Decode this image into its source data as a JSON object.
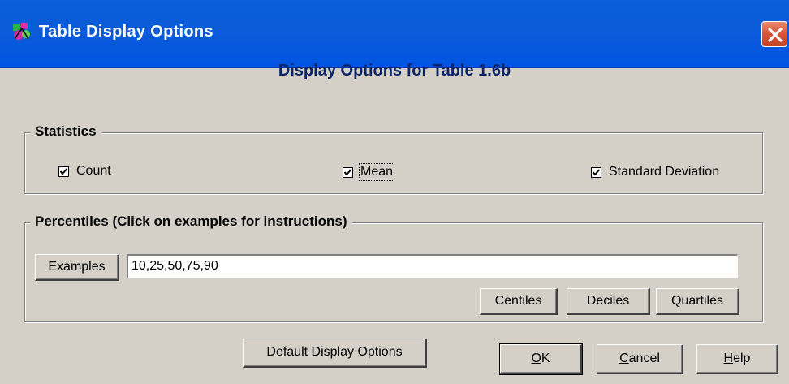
{
  "window": {
    "title": "Table Display Options",
    "app_icon": "app-icon",
    "close_icon": "close-icon"
  },
  "heading": "Display Options for Table 1.6b",
  "statistics": {
    "group_label": "Statistics",
    "count": {
      "label": "Count",
      "checked": true
    },
    "mean": {
      "label": "Mean",
      "checked": true
    },
    "std_dev": {
      "label": "Standard Deviation",
      "checked": true
    }
  },
  "percentiles": {
    "group_label": "Percentiles (Click on examples for instructions)",
    "examples_label": "Examples",
    "value": "10,25,50,75,90",
    "centiles_label": "Centiles",
    "deciles_label": "Deciles",
    "quartiles_label": "Quartiles"
  },
  "buttons": {
    "default_display_options": "Default Display Options",
    "ok_accel": "O",
    "ok_rest": "K",
    "cancel_accel": "C",
    "cancel_rest": "ancel",
    "help_accel": "H",
    "help_rest": "elp"
  },
  "colors": {
    "titlebar": "#0054e3",
    "heading": "#0a246a",
    "dialog_bg": "#d4d0c8",
    "close_button": "#d6553a"
  }
}
